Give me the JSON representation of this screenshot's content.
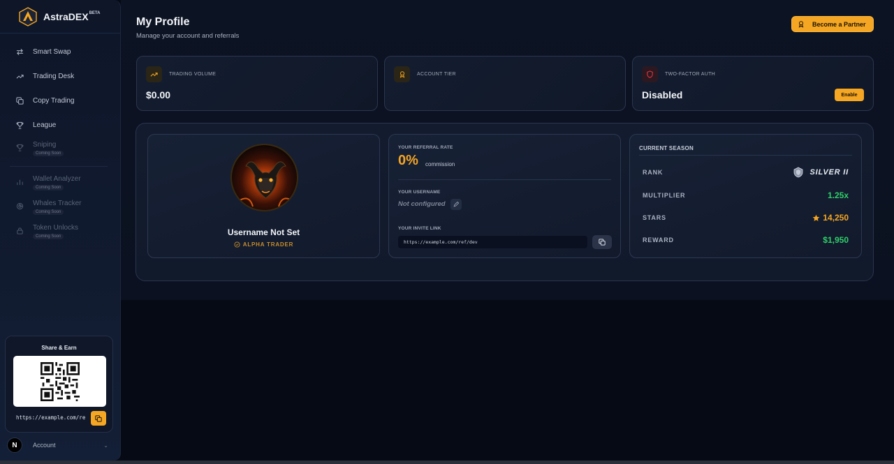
{
  "app": {
    "name": "AstraDEX",
    "badge": "BETA"
  },
  "sidebar": {
    "items": [
      {
        "label": "Smart Swap",
        "icon": "swap-icon",
        "enabled": true
      },
      {
        "label": "Trading Desk",
        "icon": "trend-icon",
        "enabled": true
      },
      {
        "label": "Copy Trading",
        "icon": "copy-icon",
        "enabled": true
      },
      {
        "label": "League",
        "icon": "trophy-icon",
        "enabled": true
      },
      {
        "label": "Sniping",
        "icon": "trophy-icon",
        "enabled": false,
        "tag": "Coming Soon"
      },
      {
        "label": "Wallet Analyzer",
        "icon": "bar-chart-icon",
        "enabled": false,
        "tag": "Coming Soon"
      },
      {
        "label": "Whales Tracker",
        "icon": "radar-icon",
        "enabled": false,
        "tag": "Coming Soon"
      },
      {
        "label": "Token Unlocks",
        "icon": "lock-icon",
        "enabled": false,
        "tag": "Coming Soon"
      }
    ],
    "share": {
      "title": "Share & Earn",
      "url": "https://example.com/re"
    },
    "account": {
      "avatar_letter": "N",
      "label": "Account"
    }
  },
  "header": {
    "title": "My Profile",
    "subtitle": "Manage your account and referrals",
    "partner_button": "Become a Partner"
  },
  "stats": {
    "trading_volume": {
      "label": "TRADING VOLUME",
      "value": "$0.00"
    },
    "account_tier": {
      "label": "ACCOUNT TIER",
      "value": ""
    },
    "two_factor": {
      "label": "TWO-FACTOR AUTH",
      "value": "Disabled",
      "button": "Enable"
    }
  },
  "profile": {
    "username": "Username Not Set",
    "badge": "ALPHA TRADER"
  },
  "referral": {
    "rate_label": "YOUR REFERRAL RATE",
    "rate_value": "0%",
    "rate_suffix": "commission",
    "username_label": "YOUR USERNAME",
    "username_value": "Not configured",
    "invite_label": "YOUR INVITE LINK",
    "invite_link": "https://example.com/ref/dev"
  },
  "season": {
    "title": "CURRENT SEASON",
    "rows": [
      {
        "key": "RANK",
        "value": "SILVER II"
      },
      {
        "key": "MULTIPLIER",
        "value": "1.25x"
      },
      {
        "key": "STARS",
        "value": "14,250"
      },
      {
        "key": "REWARD",
        "value": "$1,950"
      }
    ]
  },
  "colors": {
    "accent": "#f5a623",
    "positive": "#2fd06a",
    "danger": "#e0343f",
    "background": "#060a14"
  }
}
